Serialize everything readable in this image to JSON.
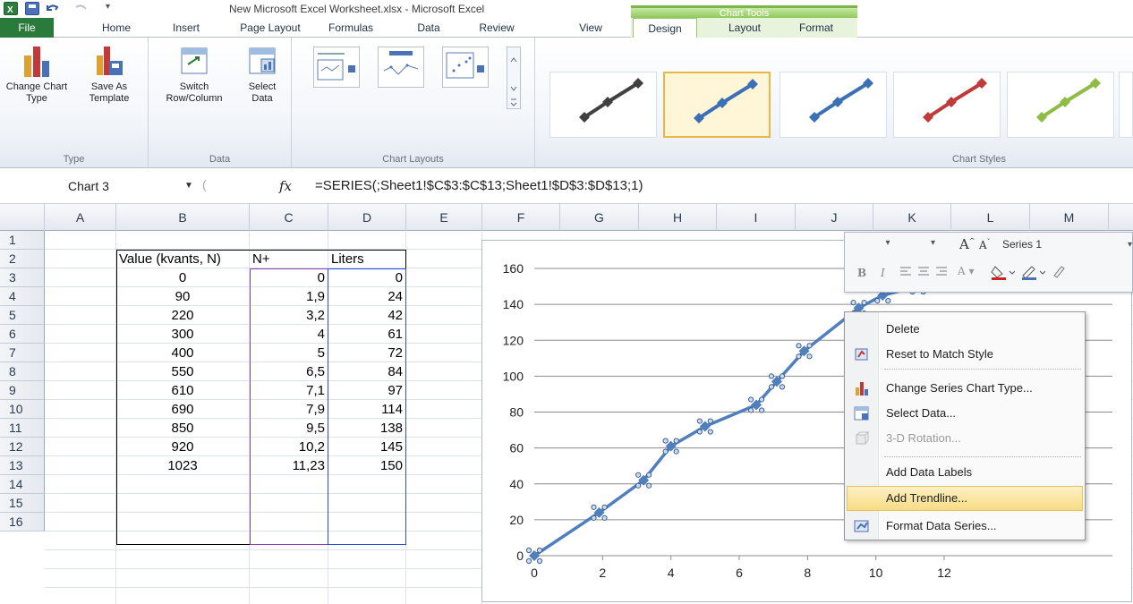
{
  "app": {
    "title": "New Microsoft Excel Worksheet.xlsx  -  Microsoft Excel",
    "context_tab_group": "Chart Tools"
  },
  "tabs": [
    "File",
    "Home",
    "Insert",
    "Page Layout",
    "Formulas",
    "Data",
    "Review",
    "View",
    "Design",
    "Layout",
    "Format"
  ],
  "ribbon": {
    "type_group": {
      "label": "Type",
      "change_chart_type": "Change Chart Type",
      "save_as_template": "Save As Template"
    },
    "data_group": {
      "label": "Data",
      "switch_row_column": "Switch Row/Column",
      "select_data": "Select Data"
    },
    "layouts_group": {
      "label": "Chart Layouts"
    },
    "styles_group": {
      "label": "Chart Styles",
      "style_colors": [
        "#404040",
        "#3b6fb6",
        "#3b6fb6",
        "#c0393b",
        "#8fbc45"
      ]
    }
  },
  "formula_bar": {
    "name_box": "Chart 3",
    "fx": "fx",
    "formula": "=SERIES(;Sheet1!$C$3:$C$13;Sheet1!$D$3:$D$13;1)"
  },
  "columns": [
    "A",
    "B",
    "C",
    "D",
    "E",
    "F",
    "G",
    "H",
    "I",
    "J",
    "K",
    "L",
    "M"
  ],
  "rows": [
    "1",
    "2",
    "3",
    "4",
    "5",
    "6",
    "7",
    "8",
    "9",
    "10",
    "11",
    "12",
    "13",
    "14",
    "15",
    "16"
  ],
  "table": {
    "headers": [
      "Value (kvants, N)",
      "N+",
      "Liters"
    ],
    "rows": [
      [
        "0",
        "0",
        "0"
      ],
      [
        "90",
        "1,9",
        "24"
      ],
      [
        "220",
        "3,2",
        "42"
      ],
      [
        "300",
        "4",
        "61"
      ],
      [
        "400",
        "5",
        "72"
      ],
      [
        "550",
        "6,5",
        "84"
      ],
      [
        "610",
        "7,1",
        "97"
      ],
      [
        "690",
        "7,9",
        "114"
      ],
      [
        "850",
        "9,5",
        "138"
      ],
      [
        "920",
        "10,2",
        "145"
      ],
      [
        "1023",
        "11,23",
        "150"
      ]
    ]
  },
  "chart_data": {
    "type": "line",
    "title": "",
    "xlabel": "",
    "ylabel": "",
    "series": [
      {
        "name": "Series 1",
        "x": [
          0,
          1.9,
          3.2,
          4,
          5,
          6.5,
          7.1,
          7.9,
          9.5,
          10.2,
          11.23
        ],
        "values": [
          0,
          24,
          42,
          61,
          72,
          84,
          97,
          114,
          138,
          145,
          150
        ],
        "color": "#4f7fbd"
      }
    ],
    "xlim": [
      0,
      12
    ],
    "ylim": [
      0,
      160
    ],
    "xticks": [
      "0",
      "2",
      "4",
      "6",
      "8",
      "10",
      "12"
    ],
    "yticks": [
      "0",
      "20",
      "40",
      "60",
      "80",
      "100",
      "120",
      "140",
      "160"
    ],
    "grid": "horizontal",
    "legend": "none"
  },
  "mini_toolbar": {
    "series_select": "Series 1",
    "grow_font": "A",
    "shrink_font": "A",
    "bold": "B",
    "italic": "I"
  },
  "context_menu": {
    "items": [
      {
        "label": "Delete",
        "enabled": true
      },
      {
        "label": "Reset to Match Style",
        "enabled": true
      },
      {
        "label": "Change Series Chart Type...",
        "enabled": true
      },
      {
        "label": "Select Data...",
        "enabled": true
      },
      {
        "label": "3-D Rotation...",
        "enabled": false
      },
      {
        "label": "Add Data Labels",
        "enabled": true
      },
      {
        "label": "Add Trendline...",
        "enabled": true,
        "highlighted": true
      },
      {
        "label": "Format Data Series...",
        "enabled": true
      }
    ]
  }
}
